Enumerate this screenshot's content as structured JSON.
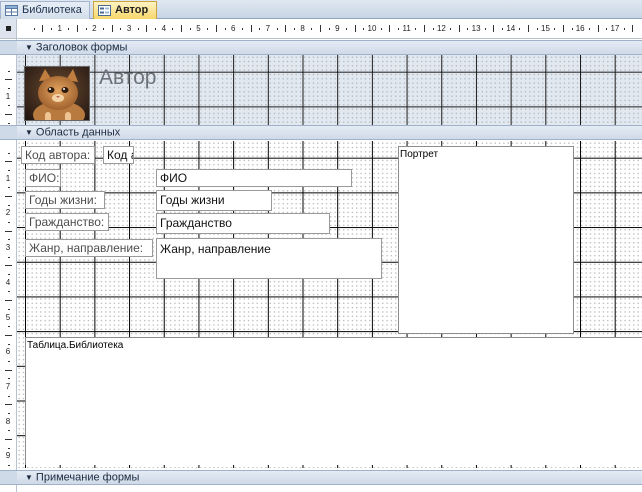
{
  "tabs": [
    {
      "label": "Библиотека",
      "active": false,
      "icon": "table-icon"
    },
    {
      "label": "Автор",
      "active": true,
      "icon": "form-icon"
    }
  ],
  "ruler": {
    "horizontal": [
      "1",
      "2",
      "3",
      "4",
      "5",
      "6",
      "7",
      "8",
      "9",
      "10",
      "11",
      "12",
      "13",
      "14",
      "15",
      "16",
      "17"
    ],
    "vertical_header": [
      "1"
    ],
    "vertical_data": [
      "1",
      "2",
      "3",
      "4",
      "5",
      "6",
      "7",
      "8",
      "9"
    ]
  },
  "sections": {
    "header": "Заголовок формы",
    "data": "Область данных",
    "footer": "Примечание формы"
  },
  "header": {
    "title": "Автор",
    "photo_icon": "cat-photo"
  },
  "fields": [
    {
      "label": "Код автора:",
      "value": "Код а"
    },
    {
      "label": "ФИО:",
      "value": "ФИО"
    },
    {
      "label": "Годы жизни:",
      "value": "Годы жизни"
    },
    {
      "label": "Гражданство:",
      "value": "Гражданство"
    },
    {
      "label": "Жанр, направление:",
      "value": "Жанр, направление"
    }
  ],
  "portrait": {
    "label": "Портрет"
  },
  "subform": {
    "label": "Таблица.Библиотека"
  },
  "colors": {
    "active_tab": "#f7d66a",
    "section_bar": "#cfdae8",
    "grid_line": "#000000"
  }
}
